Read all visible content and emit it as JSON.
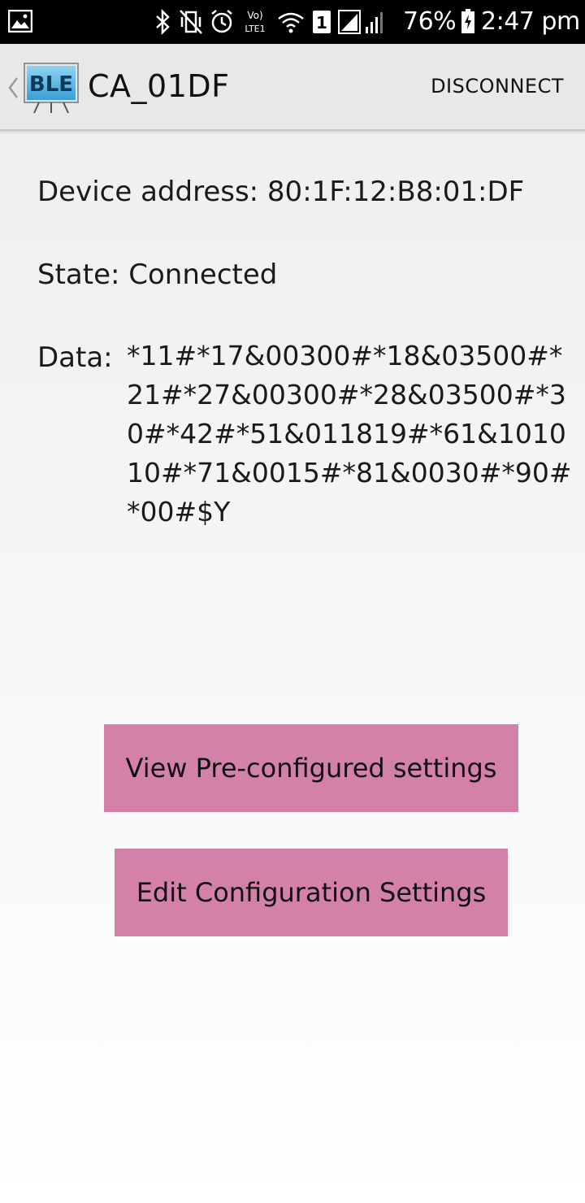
{
  "status_bar": {
    "battery": "76%",
    "time": "2:47 pm",
    "icons": [
      "gallery-icon",
      "bluetooth-icon",
      "vibrate-icon",
      "alarm-icon",
      "volte-icon",
      "wifi-icon",
      "sim-1-icon",
      "signal-icon",
      "battery-charging-icon"
    ],
    "volte_label": "Vo)",
    "lte_label": "LTE1",
    "sim_label": "1"
  },
  "action_bar": {
    "logo_text": "BLE",
    "title": "CA_01DF",
    "action_label": "DISCONNECT"
  },
  "device": {
    "address_line": "Device address: 80:1F:12:B8:01:DF",
    "state_line": "State: Connected",
    "data_label": "Data:",
    "data_value": "*11#*17&00300#*18&03500#*21#*27&00300#*28&03500#*30#*42#*51&011819#*61&101010#*71&0015#*81&0030#*90#*00#$Y"
  },
  "buttons": {
    "view_preconfigured": "View Pre-configured settings",
    "edit_configuration": "Edit Configuration Settings"
  },
  "colors": {
    "button_bg": "#d481a9",
    "status_bar_bg": "#000000",
    "action_bar_bg": "#e8e8e8"
  }
}
